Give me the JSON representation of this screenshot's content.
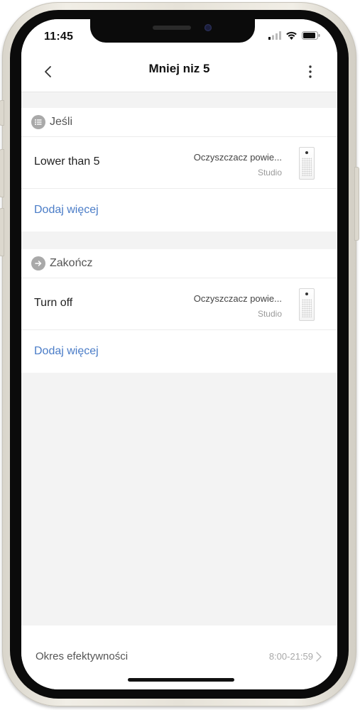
{
  "status_bar": {
    "time": "11:45"
  },
  "navbar": {
    "title": "Mniej niz 5"
  },
  "if_section": {
    "header": "Jeśli",
    "row": {
      "label": "Lower than 5",
      "device": "Oczyszczacz powie...",
      "room": "Studio"
    },
    "add_more": "Dodaj więcej"
  },
  "then_section": {
    "header": "Zakończ",
    "row": {
      "label": "Turn off",
      "device": "Oczyszczacz powie...",
      "room": "Studio"
    },
    "add_more": "Dodaj więcej"
  },
  "footer": {
    "label": "Okres efektywności",
    "value": "8:00-21:59"
  },
  "icons": {
    "back": "chevron-left-icon",
    "more": "more-vertical-icon",
    "if_header": "list-icon",
    "then_header": "arrow-right-icon",
    "footer": "chevron-right-icon"
  },
  "colors": {
    "link": "#4a7cc7",
    "background": "#f3f3f3"
  }
}
